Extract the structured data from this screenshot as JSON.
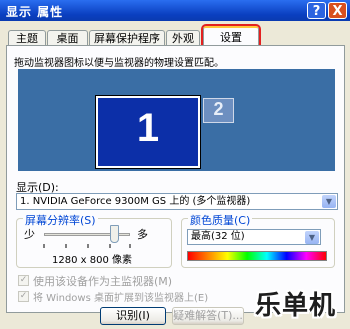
{
  "window": {
    "title": "显示 属性",
    "help_label": "?",
    "close_label": "X"
  },
  "tabs": [
    {
      "label": "主题"
    },
    {
      "label": "桌面"
    },
    {
      "label": "屏幕保护程序"
    },
    {
      "label": "外观"
    },
    {
      "label": "设置"
    }
  ],
  "settings": {
    "instruction": "拖动监视器图标以便与监视器的物理设置匹配。",
    "monitors": [
      {
        "number": "1"
      },
      {
        "number": "2"
      }
    ],
    "display_label": "显示(D):",
    "display_value": "1. NVIDIA GeForce 9300M GS 上的 (多个监视器)",
    "resolution": {
      "title": "屏幕分辨率(S)",
      "less_label": "少",
      "more_label": "多",
      "value_text": "1280 x 800 像素",
      "slider_level": 0.82
    },
    "color_quality": {
      "title": "颜色质量(C)",
      "value": "最高(32 位)"
    },
    "checkboxes": [
      {
        "label": "使用该设备作为主监视器(M)",
        "checked": true
      },
      {
        "label": "将 Windows 桌面扩展到该监视器上(E)",
        "checked": true
      }
    ],
    "buttons": {
      "identify": "识别(I)",
      "troubleshoot": "疑难解答(T)..."
    }
  },
  "watermark": "乐单机",
  "colors": {
    "desktop_blue": "#3a6ea5",
    "selected_monitor": "#0c2fa8",
    "highlight_red": "#e32020"
  }
}
